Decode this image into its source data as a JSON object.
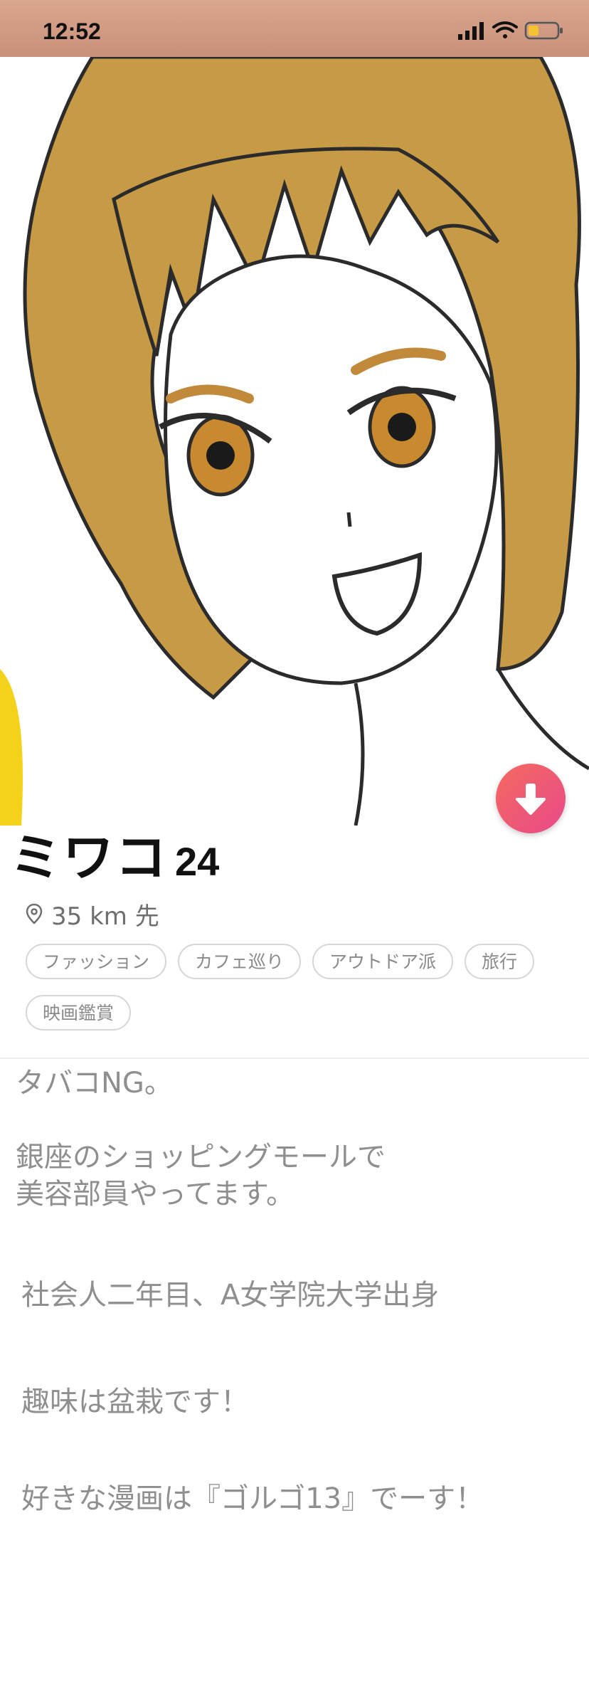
{
  "status_bar": {
    "time": "12:52",
    "icons": [
      "signal-icon",
      "wifi-icon",
      "battery-icon"
    ],
    "background": "#c9907a"
  },
  "photo": {
    "description_icon": "profile-illustration"
  },
  "actions": {
    "down_button_icon": "arrow-down-icon",
    "accent_gradient": [
      "#f46a5f",
      "#e84a8a"
    ]
  },
  "profile": {
    "name": "ミワコ",
    "age": "24",
    "distance": "35 km 先",
    "distance_icon": "location-pin-icon",
    "tags": [
      "ファッション",
      "カフェ巡り",
      "アウトドア派",
      "旅行",
      "映画鑑賞"
    ]
  },
  "bio": {
    "line1": "タバコNG。",
    "line2": "銀座のショッピングモールで",
    "line3": "美容部員やってます。",
    "line4": "社会人二年目、A女学院大学出身",
    "line5": "趣味は盆栽です！",
    "line6": "好きな漫画は『ゴルゴ13』でーす！"
  }
}
